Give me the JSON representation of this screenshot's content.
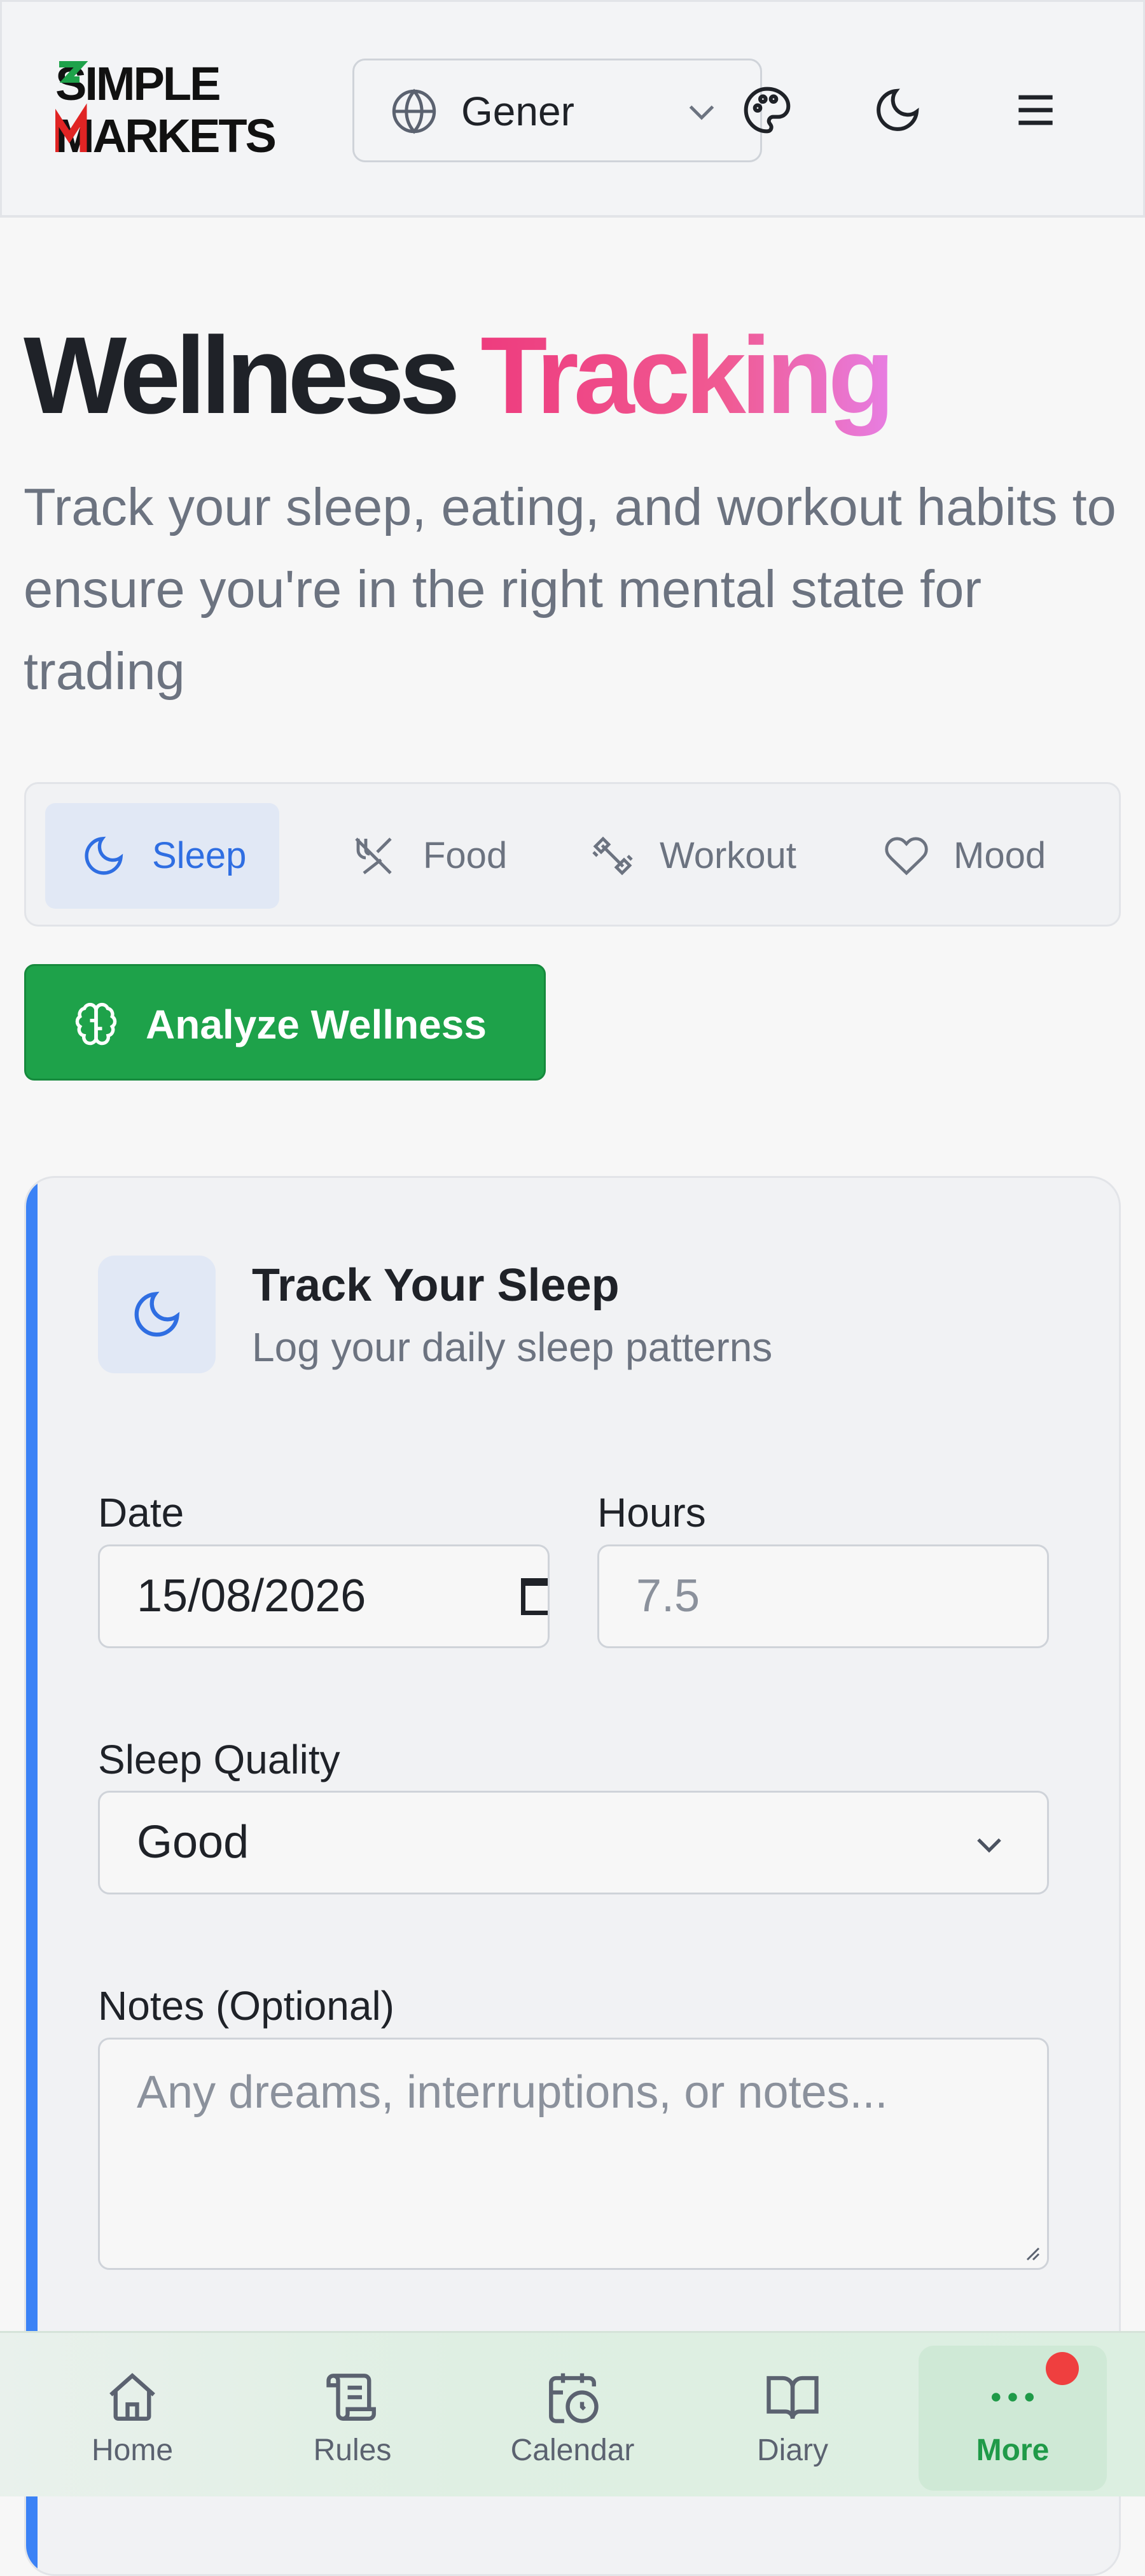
{
  "header": {
    "logo_text_line1": "SIMPLE",
    "logo_text_line2": "MARKETS",
    "language_select": {
      "value": "Gener",
      "icon": "globe-icon"
    },
    "icons": [
      "palette-icon",
      "moon-icon",
      "menu-icon"
    ]
  },
  "page": {
    "title_main": "Wellness",
    "title_accent": "Tracking",
    "subtitle": "Track your sleep, eating, and workout habits to ensure you're in the right mental state for trading"
  },
  "tabs": [
    {
      "label": "Sleep",
      "icon": "moon-icon",
      "active": true
    },
    {
      "label": "Food",
      "icon": "utensils-icon",
      "active": false
    },
    {
      "label": "Workout",
      "icon": "dumbbell-icon",
      "active": false
    },
    {
      "label": "Mood",
      "icon": "heart-icon",
      "active": false
    }
  ],
  "analyze_button": {
    "label": "Analyze Wellness",
    "icon": "brain-icon"
  },
  "sleep_card": {
    "title": "Track Your Sleep",
    "subtitle": "Log your daily sleep patterns",
    "date": {
      "label": "Date",
      "value": "15/08/2026"
    },
    "hours": {
      "label": "Hours",
      "placeholder": "7.5"
    },
    "quality": {
      "label": "Sleep Quality",
      "value": "Good"
    },
    "notes": {
      "label": "Notes (Optional)",
      "placeholder": "Any dreams, interruptions, or notes..."
    }
  },
  "bottom_nav": [
    {
      "label": "Home",
      "icon": "home-icon"
    },
    {
      "label": "Rules",
      "icon": "scroll-icon"
    },
    {
      "label": "Calendar",
      "icon": "calendar-clock-icon"
    },
    {
      "label": "Diary",
      "icon": "book-icon"
    },
    {
      "label": "More",
      "icon": "more-dots-icon",
      "active": true,
      "has_notification": true
    }
  ],
  "colors": {
    "accent_blue": "#3b82f6",
    "primary_green": "#1ea24a",
    "title_gradient_start": "#ee3c7e",
    "title_gradient_end": "#e77ee2",
    "notification_red": "#ef3f3f"
  }
}
